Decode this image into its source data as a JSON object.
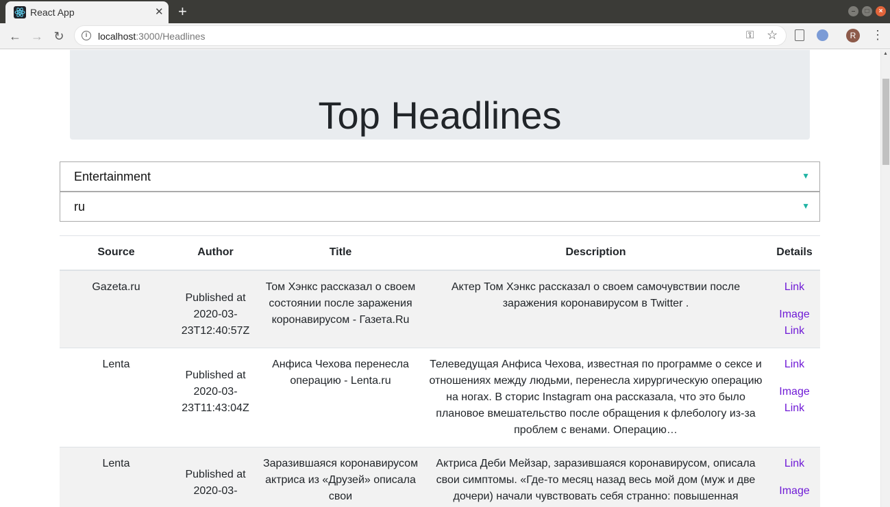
{
  "browser": {
    "tab_title": "React App",
    "url_host": "localhost",
    "url_rest": ":3000/Headlines",
    "avatar_letter": "R"
  },
  "page": {
    "heading": "Top Headlines",
    "category_select": "Entertainment",
    "country_select": "ru"
  },
  "table": {
    "headers": [
      "Source",
      "Author",
      "Title",
      "Description",
      "Details"
    ],
    "rows": [
      {
        "source": "Gazeta.ru",
        "author": "Published at 2020-03-23T12:40:57Z",
        "title": "Том Хэнкс рассказал о своем состоянии после заражения коронавирусом - Газета.Ru",
        "description": "Актер Том Хэнкс рассказал о своем самочувствии после заражения коронавирусом в Twitter .",
        "link_label": "Link",
        "image_link_label": "Image Link"
      },
      {
        "source": "Lenta",
        "author": "Published at 2020-03-23T11:43:04Z",
        "title": "Анфиса Чехова перенесла операцию - Lenta.ru",
        "description": "Телеведущая Анфиса Чехова, известная по программе о сексе и отношениях между людьми, перенесла хирургическую операцию на ногах. В сторис Instagram она рассказала, что это было плановое вмешательство после обращения к флебологу из-за проблем с венами. Операцию…",
        "link_label": "Link",
        "image_link_label": "Image Link"
      },
      {
        "source": "Lenta",
        "author": "Published at 2020-03-",
        "title": "Заразившаяся коронавирусом актриса из «Друзей» описала свои",
        "description": "Актриса Деби Мейзар, заразившаяся коронавирусом, описала свои симптомы. «Где-то месяц назад весь мой дом (муж и две дочери) начали чувствовать себя странно: повышенная",
        "link_label": "Link",
        "image_link_label": "Image"
      }
    ]
  }
}
